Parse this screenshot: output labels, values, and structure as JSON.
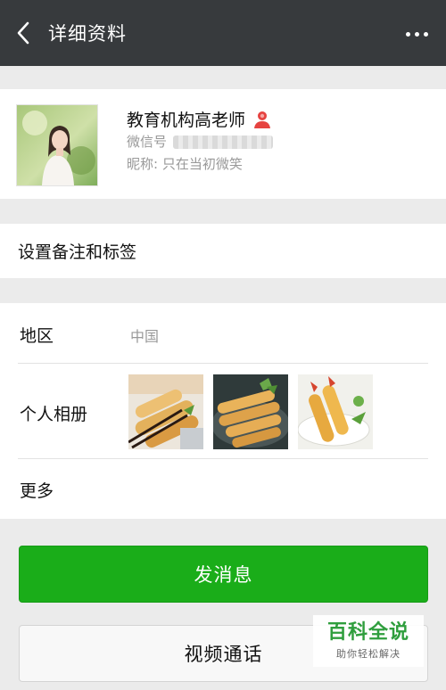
{
  "header": {
    "title": "详细资料",
    "back_icon": "chevron-left-icon",
    "more_icon": "more-horizontal-icon"
  },
  "profile": {
    "name": "教育机构高老师",
    "gender_icon": "female-user-icon",
    "gender_color": "#e64340",
    "wechat_id_label": "微信号",
    "wechat_id_value": "",
    "nickname_label": "昵称:",
    "nickname_value": "只在当初微笑"
  },
  "remark": {
    "label": "设置备注和标签"
  },
  "details": {
    "region_label": "地区",
    "region_value": "中国",
    "album_label": "个人相册",
    "more_label": "更多"
  },
  "actions": {
    "send_message": "发消息",
    "video_call": "视频通话",
    "primary_color": "#1aad19"
  },
  "watermark": {
    "title": "百科全说",
    "subtitle": "助你轻松解决"
  }
}
